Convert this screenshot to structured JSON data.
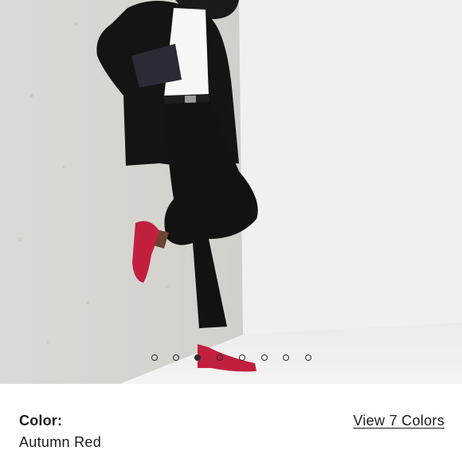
{
  "product_image": {
    "alt_icon": "product-photo",
    "slide_count": 8,
    "active_slide": 3
  },
  "color_section": {
    "label": "Color:",
    "value": "Autumn Red",
    "view_colors_link": "View 7 Colors"
  },
  "colors": {
    "background": "#ffffff",
    "text": "#1c1c1c",
    "shoe": "#c0203e"
  }
}
